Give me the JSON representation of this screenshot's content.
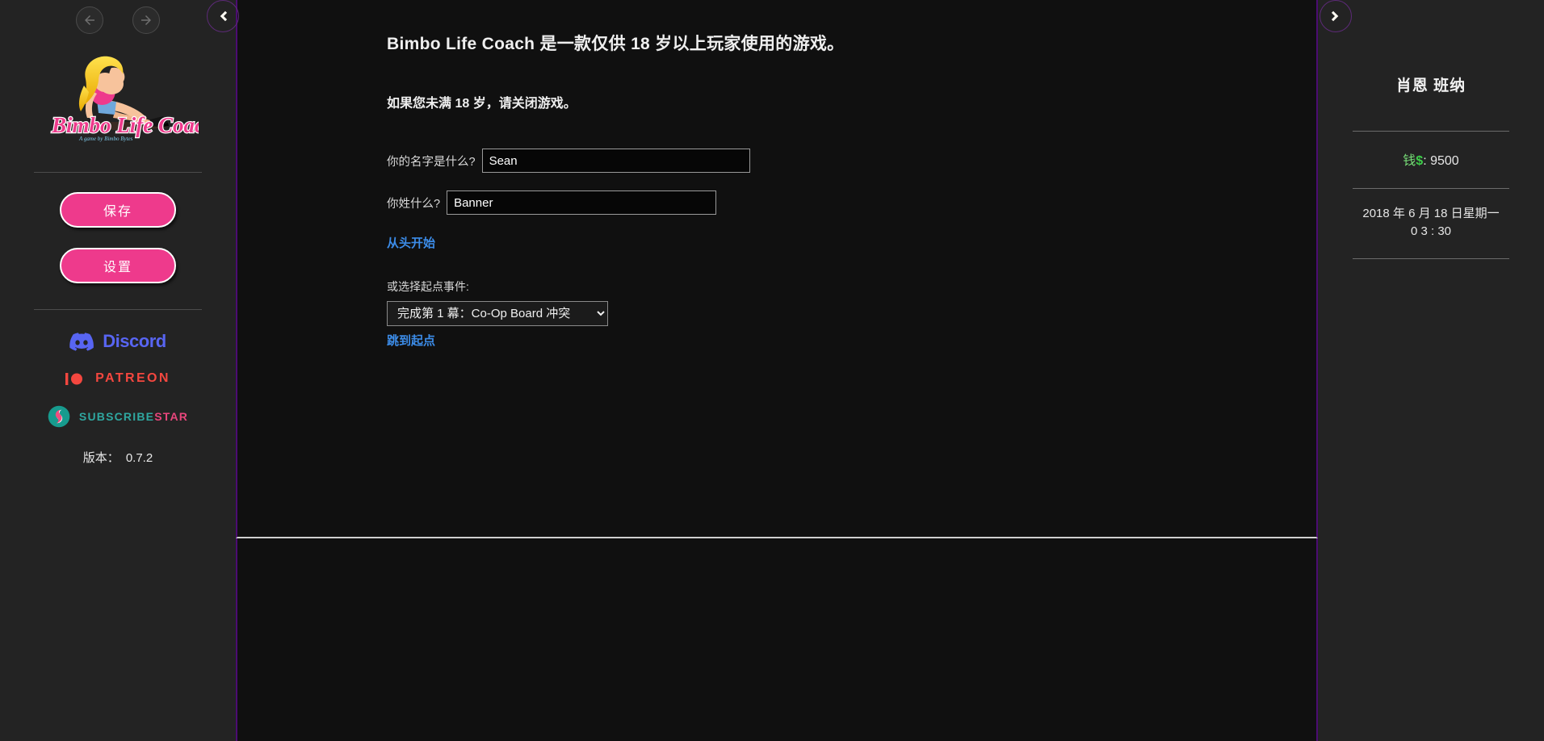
{
  "sidebar": {
    "nav": {
      "back_icon": "arrow-left-icon",
      "forward_icon": "arrow-right-icon"
    },
    "logo_alt": "Bimbo Life Coach",
    "logo_text": "Bimbo Life Coach",
    "buttons": [
      {
        "label": "保存",
        "name": "save-button"
      },
      {
        "label": "设置",
        "name": "settings-button"
      }
    ],
    "social": [
      {
        "label": "Discord",
        "icon": "discord-icon",
        "color": "#5865f2"
      },
      {
        "label": "PATREON",
        "icon": "patreon-icon",
        "color": "#f4473f"
      },
      {
        "label_a": "SUBSCRIBE",
        "label_b": "STAR",
        "icon": "subscribestar-icon",
        "color_a": "#2fa7a0",
        "color_b": "#e8467c"
      }
    ],
    "version_label": "版本：",
    "version_value": "0.7.2",
    "collapse_icon": "chevron-left-icon"
  },
  "main": {
    "headline": "Bimbo Life Coach 是一款仅供 18 岁以上玩家使用的游戏。",
    "subline": "如果您未满 18 岁，请关闭游戏。",
    "first_name_label": "你的名字是什么?",
    "first_name_value": "Sean",
    "first_name_placeholder": "",
    "last_name_label": "你姓什么?",
    "last_name_value": "Banner",
    "last_name_placeholder": "",
    "start_link": "从头开始",
    "select_label": "或选择起点事件:",
    "select_value": "完成第 1 幕：Co-Op Board 冲突",
    "select_options": [
      "完成第 1 幕：Co-Op Board 冲突"
    ],
    "jump_link": "跳到起点"
  },
  "right": {
    "expand_icon": "chevron-right-icon",
    "character_name": "肖恩 班纳",
    "money_label": "钱",
    "money_symbol": "$",
    "money_separator": ":",
    "money_value": "9500",
    "date_line1": "2018 年 6 月 18 日星期一",
    "date_line2": "0 3 : 30"
  },
  "colors": {
    "accent_pink": "#ee3a8c",
    "panel_border_purple": "#4b0c72",
    "link_blue": "#3c8ce8",
    "money_green": "#3ecf4a",
    "background": "#232323",
    "scene_background": "#101010"
  }
}
